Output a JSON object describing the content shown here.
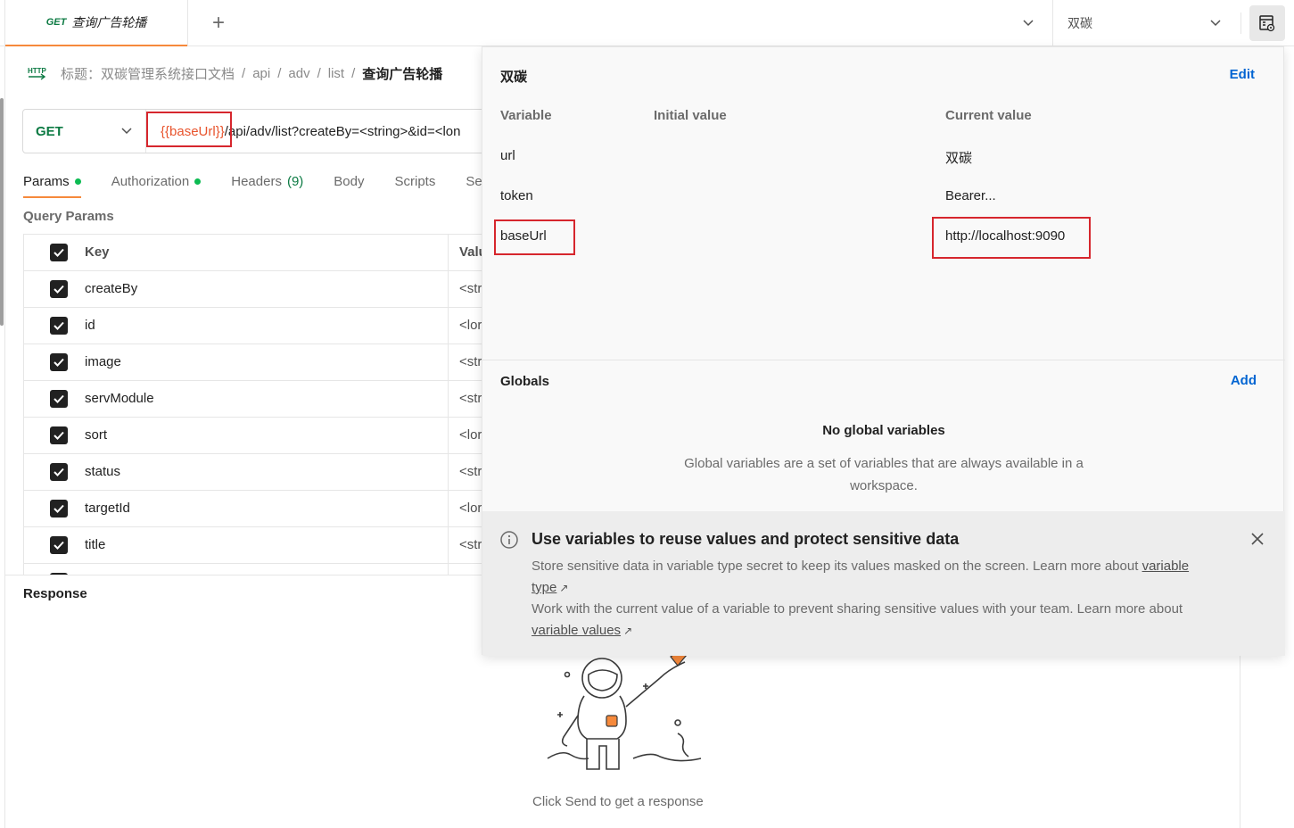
{
  "tabbar": {
    "request_tab": {
      "method": "GET",
      "name": "查询广告轮播"
    },
    "new_tab_symbol": "+",
    "environment": "双碳"
  },
  "breadcrumb": {
    "icon": "http-icon",
    "items": [
      "标题：双碳管理系统接口文档",
      "api",
      "adv",
      "list"
    ],
    "separator": "/",
    "current": "查询广告轮播"
  },
  "request": {
    "method": "GET",
    "url_variable": "{{baseUrl}}",
    "url_rest": "/api/adv/list?createBy=<string>&id=<lon"
  },
  "subtabs": [
    {
      "label": "Params",
      "dot": true,
      "active": true
    },
    {
      "label": "Authorization",
      "dot": true,
      "active": false
    },
    {
      "label": "Headers",
      "count": "(9)",
      "active": false
    },
    {
      "label": "Body",
      "active": false
    },
    {
      "label": "Scripts",
      "active": false
    },
    {
      "label": "Se",
      "active": false
    }
  ],
  "query_params": {
    "label": "Query Params",
    "header": {
      "key": "Key",
      "value": "Valu"
    },
    "rows": [
      {
        "key": "createBy",
        "value": "<str",
        "checked": true
      },
      {
        "key": "id",
        "value": "<lor",
        "checked": true
      },
      {
        "key": "image",
        "value": "<str",
        "checked": true
      },
      {
        "key": "servModule",
        "value": "<str",
        "checked": true
      },
      {
        "key": "sort",
        "value": "<lor",
        "checked": true
      },
      {
        "key": "status",
        "value": "<str",
        "checked": true
      },
      {
        "key": "targetId",
        "value": "<lor",
        "checked": true
      },
      {
        "key": "title",
        "value": "<str",
        "checked": true
      }
    ]
  },
  "response": {
    "label": "Response",
    "hint": "Click Send to get a response"
  },
  "env_popover": {
    "title": "双碳",
    "edit_label": "Edit",
    "columns": [
      "Variable",
      "Initial value",
      "Current value"
    ],
    "variables": [
      {
        "name": "url",
        "initial": "",
        "current": "双碳"
      },
      {
        "name": "token",
        "initial": "",
        "current": "Bearer..."
      },
      {
        "name": "baseUrl",
        "initial": "",
        "current": "http://localhost:9090"
      }
    ],
    "globals": {
      "title": "Globals",
      "add_label": "Add",
      "empty_title": "No global variables",
      "empty_desc": "Global variables are a set of variables that are always available in a workspace."
    },
    "tip": {
      "title": "Use variables to reuse values and protect sensitive data",
      "line1": "Store sensitive data in variable type secret to keep its values masked on the screen. Learn more about",
      "link1": "variable type",
      "line2": "Work with the current value of a variable to prevent sharing sensitive values with your team. Learn more about",
      "link2": "variable values",
      "arrow": "↗"
    }
  },
  "colors": {
    "accent_orange": "#f6893b",
    "method_green": "#0c7a43",
    "link_blue": "#0265d2",
    "highlight_red": "#d6262d",
    "variable_orange": "#e8542d",
    "dot_green": "#0cbb52"
  }
}
